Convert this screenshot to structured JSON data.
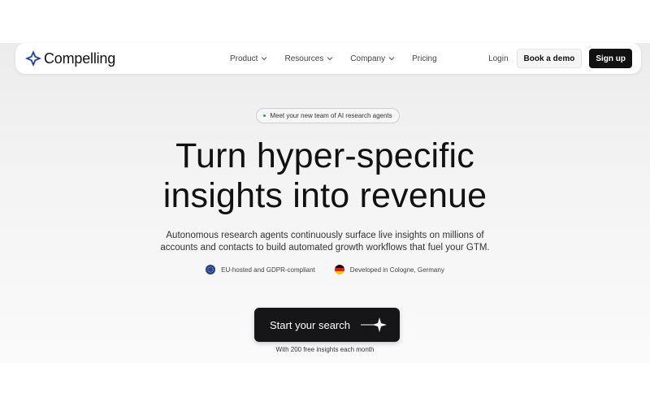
{
  "brand": {
    "name": "Compelling",
    "logo_icon": "four-point-star-icon",
    "accent_color": "#1d3f9e"
  },
  "nav": {
    "items": [
      {
        "label": "Product",
        "has_dropdown": true
      },
      {
        "label": "Resources",
        "has_dropdown": true
      },
      {
        "label": "Company",
        "has_dropdown": true
      },
      {
        "label": "Pricing",
        "has_dropdown": false
      }
    ],
    "login_label": "Login",
    "demo_label": "Book a demo",
    "signup_label": "Sign up"
  },
  "hero": {
    "pill_text": "Meet your new team of AI research agents",
    "headline_line1": "Turn hyper-specific",
    "headline_line2": "insights into revenue",
    "subtext_line1": "Autonomous research agents continuously surface live insights on millions of",
    "subtext_line2": "accounts and contacts to build automated growth workflows that fuel your GTM.",
    "badges": [
      {
        "icon": "eu-stars-icon",
        "label": "EU-hosted and GDPR-compliant"
      },
      {
        "icon": "germany-flag-icon",
        "label": "Developed in Cologne, Germany"
      }
    ],
    "cta_label": "Start your search",
    "cta_icon": "sparkle-arrow-icon",
    "cta_caption": "With 200 free insights each month"
  }
}
